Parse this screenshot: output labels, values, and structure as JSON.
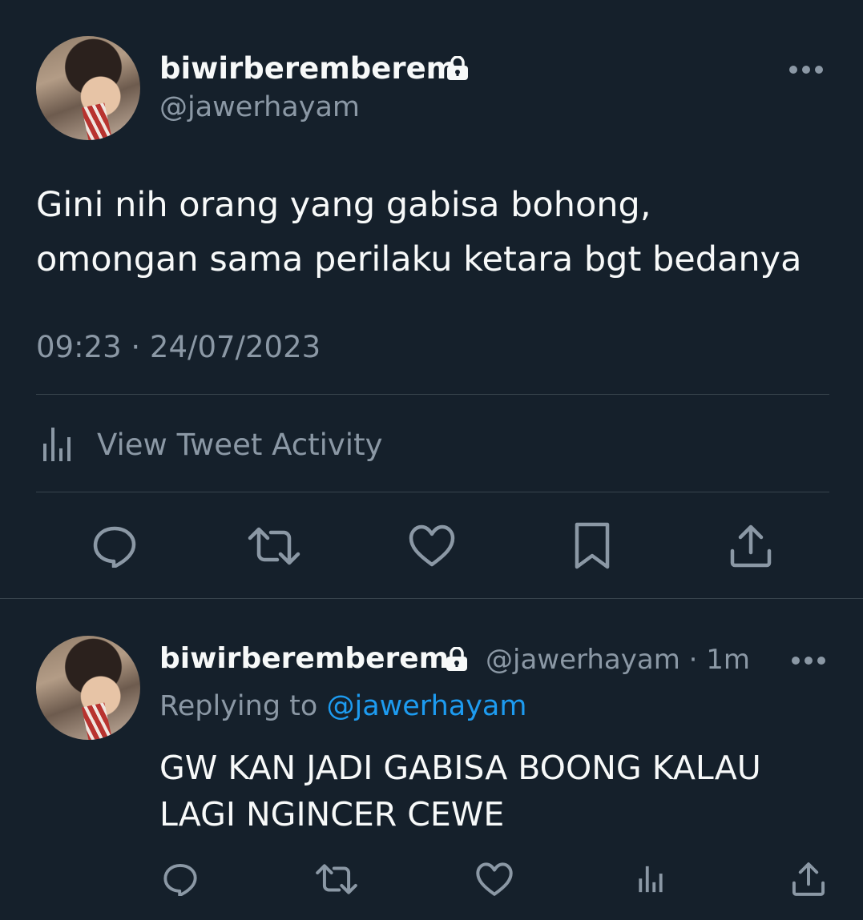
{
  "main_tweet": {
    "author_name": "biwirberemberem",
    "author_handle": "@jawerhayam",
    "text_line1": "Gini nih orang yang gabisa bohong,",
    "text_line2": "omongan sama perilaku ketara bgt bedanya",
    "timestamp": "09:23 · 24/07/2023",
    "activity_label": "View Tweet Activity",
    "icons": {
      "more": "more-horizontal-icon",
      "lock": "lock-icon",
      "activity": "analytics-icon",
      "reply": "reply-icon",
      "retweet": "retweet-icon",
      "like": "like-icon",
      "bookmark": "bookmark-icon",
      "share": "share-icon"
    }
  },
  "reply_tweet": {
    "author_name": "biwirberemberem",
    "author_handle": "@jawerhayam",
    "time_ago": "1m",
    "separator": "·",
    "replying_to_label": "Replying to",
    "replying_to_handle": "@jawerhayam",
    "text_line1": "GW KAN JADI GABISA BOONG KALAU",
    "text_line2": "LAGI NGINCER CEWE",
    "icons": {
      "reply": "reply-icon",
      "retweet": "retweet-icon",
      "like": "like-icon",
      "views": "analytics-icon",
      "share": "share-icon"
    }
  },
  "colors": {
    "background": "#15202b",
    "text_primary": "#f7f9f9",
    "text_secondary": "#8b98a5",
    "link": "#1d9bf0",
    "divider": "#38444d"
  }
}
